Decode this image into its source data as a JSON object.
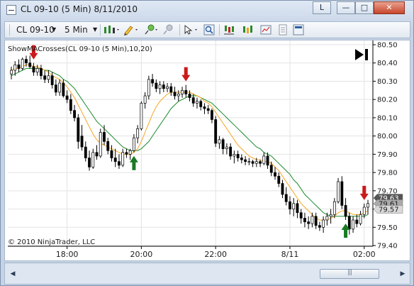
{
  "window": {
    "title": "CL 09-10 (5 Min)  8/11/2010",
    "buttons": {
      "link": "L",
      "minimize": "—",
      "maximize": "□",
      "close": "✕"
    }
  },
  "toolbar": {
    "instrument": "CL 09-10",
    "interval": "5 Min",
    "icons": [
      "bars-icon",
      "pencil-icon",
      "pin-icon",
      "pin-gray-icon",
      "cursor-icon",
      "zoom-icon",
      "indicators-icon",
      "strategies-icon",
      "properties-icon",
      "data-box-icon"
    ]
  },
  "chart_data": {
    "type": "candlestick",
    "indicator_label": "ShowMACrosses(CL 09-10 (5 Min),10,20)",
    "copyright": "© 2010 NinjaTrader, LLC",
    "x_tick_labels": [
      "18:00",
      "20:00",
      "22:00",
      "8/11",
      "02:00"
    ],
    "y_tick_labels": [
      "80.50",
      "80.40",
      "80.30",
      "80.20",
      "80.10",
      "80.00",
      "79.90",
      "79.80",
      "79.70",
      "79.60",
      "79.50",
      "79.40"
    ],
    "ylim": [
      79.4,
      80.5
    ],
    "last_price_badges": [
      "79.63",
      "79.61",
      "79.57"
    ],
    "colors": {
      "up": "#ffffff",
      "down": "#000000",
      "fast_ma": "#f5a623",
      "slow_ma": "#1b8a2c",
      "up_arrow": "#1a7a24",
      "down_arrow": "#cc1a1a"
    },
    "candles": [
      [
        80.34,
        80.38,
        80.31,
        80.36
      ],
      [
        80.36,
        80.41,
        80.33,
        80.39
      ],
      [
        80.39,
        80.42,
        80.35,
        80.37
      ],
      [
        80.37,
        80.43,
        80.36,
        80.42
      ],
      [
        80.42,
        80.44,
        80.38,
        80.4
      ],
      [
        80.4,
        80.44,
        80.37,
        80.38
      ],
      [
        80.38,
        80.4,
        80.33,
        80.35
      ],
      [
        80.35,
        80.39,
        80.33,
        80.37
      ],
      [
        80.37,
        80.39,
        80.31,
        80.33
      ],
      [
        80.33,
        80.36,
        80.29,
        80.31
      ],
      [
        80.31,
        80.36,
        80.29,
        80.33
      ],
      [
        80.33,
        80.35,
        80.26,
        80.28
      ],
      [
        80.28,
        80.31,
        80.22,
        80.24
      ],
      [
        80.24,
        80.31,
        80.22,
        80.29
      ],
      [
        80.29,
        80.31,
        80.21,
        80.22
      ],
      [
        80.22,
        80.25,
        80.18,
        80.2
      ],
      [
        80.2,
        80.23,
        80.12,
        80.14
      ],
      [
        80.14,
        80.17,
        80.08,
        80.1
      ],
      [
        80.1,
        80.12,
        79.93,
        79.97
      ],
      [
        80.0,
        80.06,
        79.92,
        79.94
      ],
      [
        79.94,
        79.97,
        79.86,
        79.88
      ],
      [
        79.88,
        79.92,
        79.81,
        79.83
      ],
      [
        79.83,
        79.93,
        79.82,
        79.91
      ],
      [
        79.91,
        79.95,
        79.87,
        79.89
      ],
      [
        79.89,
        80.04,
        79.88,
        80.02
      ],
      [
        80.02,
        80.06,
        79.95,
        79.97
      ],
      [
        79.97,
        79.99,
        79.9,
        79.92
      ],
      [
        79.92,
        79.95,
        79.86,
        79.88
      ],
      [
        79.88,
        79.93,
        79.83,
        79.86
      ],
      [
        79.86,
        79.9,
        79.82,
        79.84
      ],
      [
        79.84,
        79.93,
        79.83,
        79.91
      ],
      [
        79.91,
        79.93,
        79.88,
        79.9
      ],
      [
        79.9,
        79.93,
        79.87,
        79.92
      ],
      [
        79.92,
        80.01,
        79.91,
        79.99
      ],
      [
        79.99,
        80.06,
        79.96,
        80.04
      ],
      [
        80.04,
        80.19,
        80.03,
        80.18
      ],
      [
        80.18,
        80.24,
        80.15,
        80.22
      ],
      [
        80.22,
        80.33,
        80.2,
        80.31
      ],
      [
        80.31,
        80.34,
        80.27,
        80.29
      ],
      [
        80.29,
        80.31,
        80.24,
        80.26
      ],
      [
        80.26,
        80.3,
        80.23,
        80.28
      ],
      [
        80.28,
        80.3,
        80.24,
        80.26
      ],
      [
        80.26,
        80.29,
        80.24,
        80.27
      ],
      [
        80.27,
        80.29,
        80.22,
        80.24
      ],
      [
        80.24,
        80.27,
        80.2,
        80.22
      ],
      [
        80.22,
        80.25,
        80.19,
        80.23
      ],
      [
        80.23,
        80.27,
        80.21,
        80.25
      ],
      [
        80.25,
        80.28,
        80.21,
        80.23
      ],
      [
        80.23,
        80.25,
        80.19,
        80.21
      ],
      [
        80.21,
        80.23,
        80.16,
        80.18
      ],
      [
        80.18,
        80.21,
        80.15,
        80.19
      ],
      [
        80.19,
        80.2,
        80.14,
        80.16
      ],
      [
        80.16,
        80.18,
        80.12,
        80.15
      ],
      [
        80.15,
        80.17,
        80.12,
        80.14
      ],
      [
        80.14,
        80.15,
        80.07,
        80.09
      ],
      [
        80.09,
        80.11,
        79.94,
        79.96
      ],
      [
        79.96,
        80.0,
        79.93,
        79.98
      ],
      [
        79.98,
        79.99,
        79.9,
        79.93
      ],
      [
        79.93,
        79.96,
        79.9,
        79.94
      ],
      [
        79.94,
        79.96,
        79.87,
        79.89
      ],
      [
        79.89,
        79.92,
        79.85,
        79.9
      ],
      [
        79.9,
        79.92,
        79.86,
        79.88
      ],
      [
        79.88,
        79.9,
        79.85,
        79.87
      ],
      [
        79.87,
        79.89,
        79.84,
        79.86
      ],
      [
        79.86,
        79.88,
        79.84,
        79.86
      ],
      [
        79.86,
        79.87,
        79.83,
        79.85
      ],
      [
        79.85,
        79.88,
        79.83,
        79.86
      ],
      [
        79.86,
        79.87,
        79.83,
        79.85
      ],
      [
        79.85,
        79.91,
        79.84,
        79.89
      ],
      [
        79.89,
        79.91,
        79.82,
        79.84
      ],
      [
        79.84,
        79.86,
        79.78,
        79.8
      ],
      [
        79.8,
        79.83,
        79.76,
        79.78
      ],
      [
        79.78,
        79.8,
        79.72,
        79.74
      ],
      [
        79.74,
        79.76,
        79.66,
        79.68
      ],
      [
        79.68,
        79.72,
        79.62,
        79.64
      ],
      [
        79.64,
        79.67,
        79.57,
        79.6
      ],
      [
        79.6,
        79.66,
        79.56,
        79.63
      ],
      [
        79.63,
        79.65,
        79.55,
        79.58
      ],
      [
        79.58,
        79.6,
        79.52,
        79.55
      ],
      [
        79.55,
        79.58,
        79.5,
        79.53
      ],
      [
        79.53,
        79.56,
        79.49,
        79.52
      ],
      [
        79.52,
        79.58,
        79.5,
        79.56
      ],
      [
        79.56,
        79.58,
        79.49,
        79.51
      ],
      [
        79.51,
        79.53,
        79.48,
        79.5
      ],
      [
        79.5,
        79.56,
        79.47,
        79.54
      ],
      [
        79.54,
        79.58,
        79.51,
        79.56
      ],
      [
        79.56,
        79.6,
        79.52,
        79.57
      ],
      [
        79.57,
        79.66,
        79.55,
        79.64
      ],
      [
        79.64,
        79.77,
        79.63,
        79.75
      ],
      [
        79.75,
        79.78,
        79.6,
        79.62
      ],
      [
        79.62,
        79.66,
        79.54,
        79.56
      ],
      [
        79.56,
        79.58,
        79.46,
        79.49
      ],
      [
        79.49,
        79.56,
        79.47,
        79.54
      ],
      [
        79.54,
        79.57,
        79.5,
        79.52
      ],
      [
        79.52,
        79.59,
        79.51,
        79.57
      ],
      [
        79.57,
        79.63,
        79.55,
        79.61
      ],
      [
        79.61,
        79.65,
        79.57,
        79.63
      ]
    ],
    "fast_ma": [
      80.36,
      80.37,
      80.37,
      80.38,
      80.39,
      80.39,
      80.38,
      80.38,
      80.37,
      80.36,
      80.35,
      80.33,
      80.32,
      80.31,
      80.29,
      80.27,
      80.24,
      80.21,
      80.17,
      80.13,
      80.09,
      80.05,
      80.01,
      79.98,
      79.96,
      79.95,
      79.94,
      79.93,
      79.92,
      79.91,
      79.9,
      79.9,
      79.9,
      79.91,
      79.93,
      79.97,
      80.02,
      80.07,
      80.12,
      80.16,
      80.19,
      80.21,
      80.23,
      80.24,
      80.24,
      80.24,
      80.24,
      80.24,
      80.24,
      80.23,
      80.22,
      80.21,
      80.19,
      80.18,
      80.16,
      80.13,
      80.1,
      80.07,
      80.04,
      80.01,
      79.98,
      79.95,
      79.93,
      79.91,
      79.89,
      79.88,
      79.87,
      79.87,
      79.86,
      79.86,
      79.85,
      79.83,
      79.81,
      79.78,
      79.75,
      79.72,
      79.69,
      79.66,
      79.63,
      79.61,
      79.59,
      79.57,
      79.55,
      79.54,
      79.54,
      79.54,
      79.55,
      79.56,
      79.58,
      79.59,
      79.59,
      79.58,
      79.57,
      79.57,
      79.57,
      79.58,
      79.59
    ],
    "slow_ma": [
      80.33,
      80.34,
      80.35,
      80.36,
      80.37,
      80.37,
      80.37,
      80.37,
      80.37,
      80.36,
      80.36,
      80.35,
      80.34,
      80.33,
      80.31,
      80.3,
      80.28,
      80.26,
      80.23,
      80.2,
      80.17,
      80.14,
      80.11,
      80.08,
      80.06,
      80.04,
      80.02,
      80.0,
      79.98,
      79.96,
      79.94,
      79.93,
      79.92,
      79.92,
      79.92,
      79.93,
      79.95,
      79.97,
      80.0,
      80.03,
      80.06,
      80.09,
      80.12,
      80.15,
      80.17,
      80.19,
      80.2,
      80.21,
      80.22,
      80.22,
      80.22,
      80.21,
      80.2,
      80.19,
      80.18,
      80.16,
      80.14,
      80.12,
      80.1,
      80.08,
      80.06,
      80.04,
      80.02,
      80.0,
      79.98,
      79.96,
      79.94,
      79.93,
      79.91,
      79.9,
      79.89,
      79.87,
      79.85,
      79.83,
      79.81,
      79.79,
      79.76,
      79.74,
      79.71,
      79.68,
      79.66,
      79.64,
      79.62,
      79.6,
      79.58,
      79.57,
      79.56,
      79.56,
      79.56,
      79.56,
      79.56,
      79.56,
      79.56,
      79.56,
      79.56,
      79.56,
      79.57
    ],
    "crosses": [
      {
        "index": 6,
        "dir": "down"
      },
      {
        "index": 33,
        "dir": "up"
      },
      {
        "index": 47,
        "dir": "down"
      },
      {
        "index": 90,
        "dir": "up"
      },
      {
        "index": 95,
        "dir": "down"
      }
    ]
  }
}
